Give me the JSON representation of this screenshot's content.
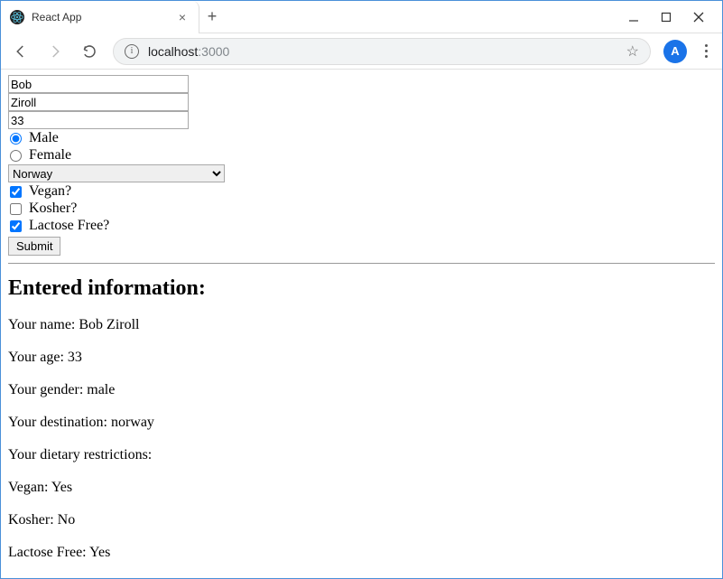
{
  "browser": {
    "tab_title": "React App",
    "url_host": "localhost",
    "url_port": ":3000",
    "avatar_letter": "A"
  },
  "form": {
    "first_name": "Bob",
    "last_name": "Ziroll",
    "age": "33",
    "gender": "male",
    "gender_labels": {
      "male": "Male",
      "female": "Female"
    },
    "destination_selected": "Norway",
    "diet": {
      "vegan": {
        "label": "Vegan?",
        "checked": true
      },
      "kosher": {
        "label": "Kosher?",
        "checked": false
      },
      "lactose": {
        "label": "Lactose Free?",
        "checked": true
      }
    },
    "submit_label": "Submit"
  },
  "output": {
    "heading": "Entered information:",
    "name_line": "Your name: Bob Ziroll",
    "age_line": "Your age: 33",
    "gender_line": "Your gender: male",
    "destination_line": "Your destination: norway",
    "diet_heading": "Your dietary restrictions:",
    "vegan_line": "Vegan: Yes",
    "kosher_line": "Kosher: No",
    "lactose_line": "Lactose Free: Yes"
  }
}
